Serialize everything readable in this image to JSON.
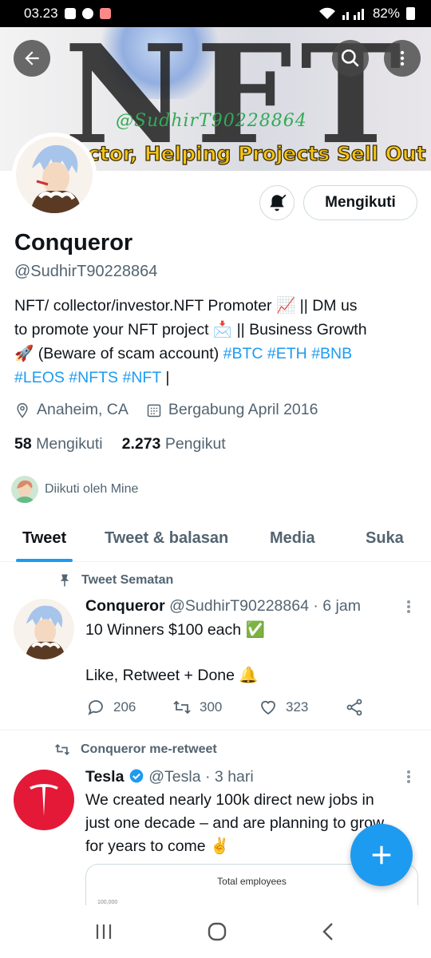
{
  "status_bar": {
    "time": "03.23",
    "battery": "82%"
  },
  "banner": {
    "bg_letters": "NFT",
    "signature": "@SudhirT90228864",
    "tagline": "ctor, Helping Projects Sell Out"
  },
  "profile": {
    "name": "Conqueror",
    "handle": "@SudhirT90228864",
    "follow_label": "Mengikuti",
    "bio": {
      "line1": "NFT/ collector/investor.NFT Promoter 📈 || DM us",
      "line2": "to promote your NFT project 📩 || Business Growth",
      "line3_prefix": "🚀  (Beware of scam account)",
      "hashtags_line3": [
        "#BTC",
        "#ETH",
        "#BNB"
      ],
      "hashtags_line4": [
        "#LEOS",
        "#NFTS",
        "#NFT"
      ],
      "suffix": "|"
    },
    "location": "Anaheim, CA",
    "joined": "Bergabung April 2016",
    "following_count": "58",
    "following_label": "Mengikuti",
    "followers_count": "2.273",
    "followers_label": "Pengikut",
    "followed_by": "Diikuti oleh Mine"
  },
  "tabs": [
    {
      "label": "Tweet"
    },
    {
      "label": "Tweet & balasan"
    },
    {
      "label": "Media"
    },
    {
      "label": "Suka"
    }
  ],
  "tweets": [
    {
      "context": "Tweet Sematan",
      "author": "Conqueror",
      "handle": "@SudhirT90228864",
      "time": "· 6 jam",
      "line1": "10 Winners $100 each ✅",
      "line2": "Like, Retweet + Done 🔔",
      "replies": "206",
      "retweets": "300",
      "likes": "323"
    },
    {
      "context": "Conqueror me-retweet",
      "author": "Tesla",
      "handle": "@Tesla",
      "time": "· 3 hari",
      "line1": "We created nearly 100k direct new jobs in",
      "line2": "just one decade – and are planning to grow",
      "line3": "for years to come ✌️",
      "card_title": "Total employees",
      "card_tick": "100,000"
    }
  ],
  "colors": {
    "accent": "#1d9bf0",
    "tesla_red": "#e31937",
    "text_secondary": "#536471"
  }
}
